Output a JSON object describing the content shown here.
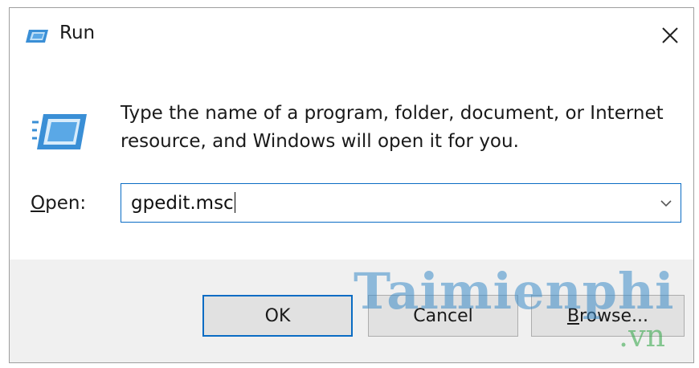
{
  "window": {
    "title": "Run",
    "icon": "run-app-icon",
    "close_icon": "close-icon"
  },
  "body": {
    "icon": "run-app-icon",
    "description": "Type the name of a program, folder, document, or Internet resource, and Windows will open it for you.",
    "open_label_prefix": "O",
    "open_label_rest": "pen:",
    "combo_value": "gpedit.msc",
    "combo_arrow_icon": "chevron-down-icon"
  },
  "buttons": {
    "ok": "OK",
    "cancel": "Cancel",
    "browse_prefix": "B",
    "browse_rest": "rowse..."
  },
  "watermark": {
    "text": "Taimienphi",
    "sub": ".vn"
  },
  "colors": {
    "accent": "#0a6cc4",
    "footer_bg": "#f0f0f0",
    "button_bg": "#e1e1e1"
  }
}
